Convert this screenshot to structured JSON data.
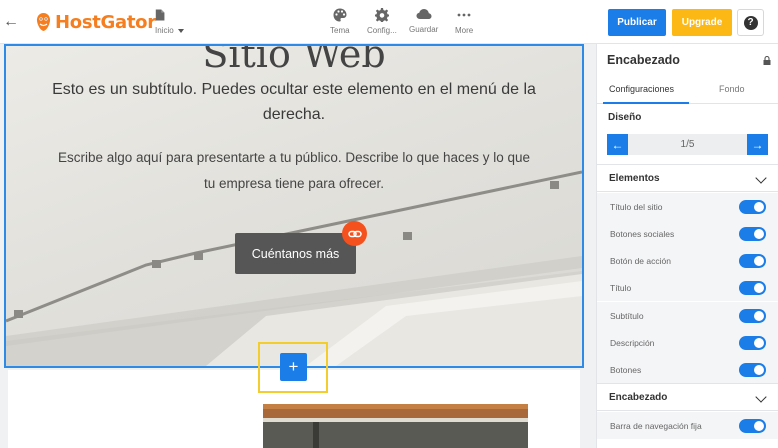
{
  "topbar": {
    "brand": "HostGator",
    "page_selector": "Inicio",
    "tools": [
      {
        "id": "tema",
        "label": "Tema",
        "icon": "palette-icon"
      },
      {
        "id": "config",
        "label": "Config...",
        "icon": "gear-icon"
      },
      {
        "id": "guardar",
        "label": "Guardar",
        "icon": "cloud-icon"
      },
      {
        "id": "more",
        "label": "More",
        "icon": "more-dots-icon"
      }
    ],
    "publish_label": "Publicar",
    "upgrade_label": "Upgrade",
    "help_label": "?"
  },
  "hero": {
    "title": "Sitio Web",
    "subtitle": "Esto es un subtítulo. Puedes ocultar este elemento en el menú de la derecha.",
    "description": "Escribe algo aquí para presentarte a tu público. Describe lo que haces y lo que tu empresa tiene para ofrecer.",
    "cta_label": "Cuéntanos más"
  },
  "add_section_label": "+",
  "panel": {
    "title": "Encabezado",
    "tabs": [
      "Configuraciones",
      "Fondo"
    ],
    "design_label": "Diseño",
    "design_page": "1/5",
    "groups": [
      {
        "title": "Elementos",
        "items": [
          {
            "label": "Título del sitio",
            "on": true
          },
          {
            "label": "Botones sociales",
            "on": true
          },
          {
            "label": "Botón de acción",
            "on": true
          },
          {
            "label": "Título",
            "on": true
          },
          {
            "label": "Subtítulo",
            "on": true
          },
          {
            "label": "Descripción",
            "on": true
          },
          {
            "label": "Botones",
            "on": true
          }
        ]
      },
      {
        "title": "Encabezado",
        "items": [
          {
            "label": "Barra de navegación fija",
            "on": true
          }
        ]
      }
    ]
  },
  "colors": {
    "accent": "#1a7de8",
    "upgrade": "#fcb814",
    "brand": "#f57f20",
    "link_badge": "#f4511e",
    "highlight": "#f2cd2d"
  }
}
